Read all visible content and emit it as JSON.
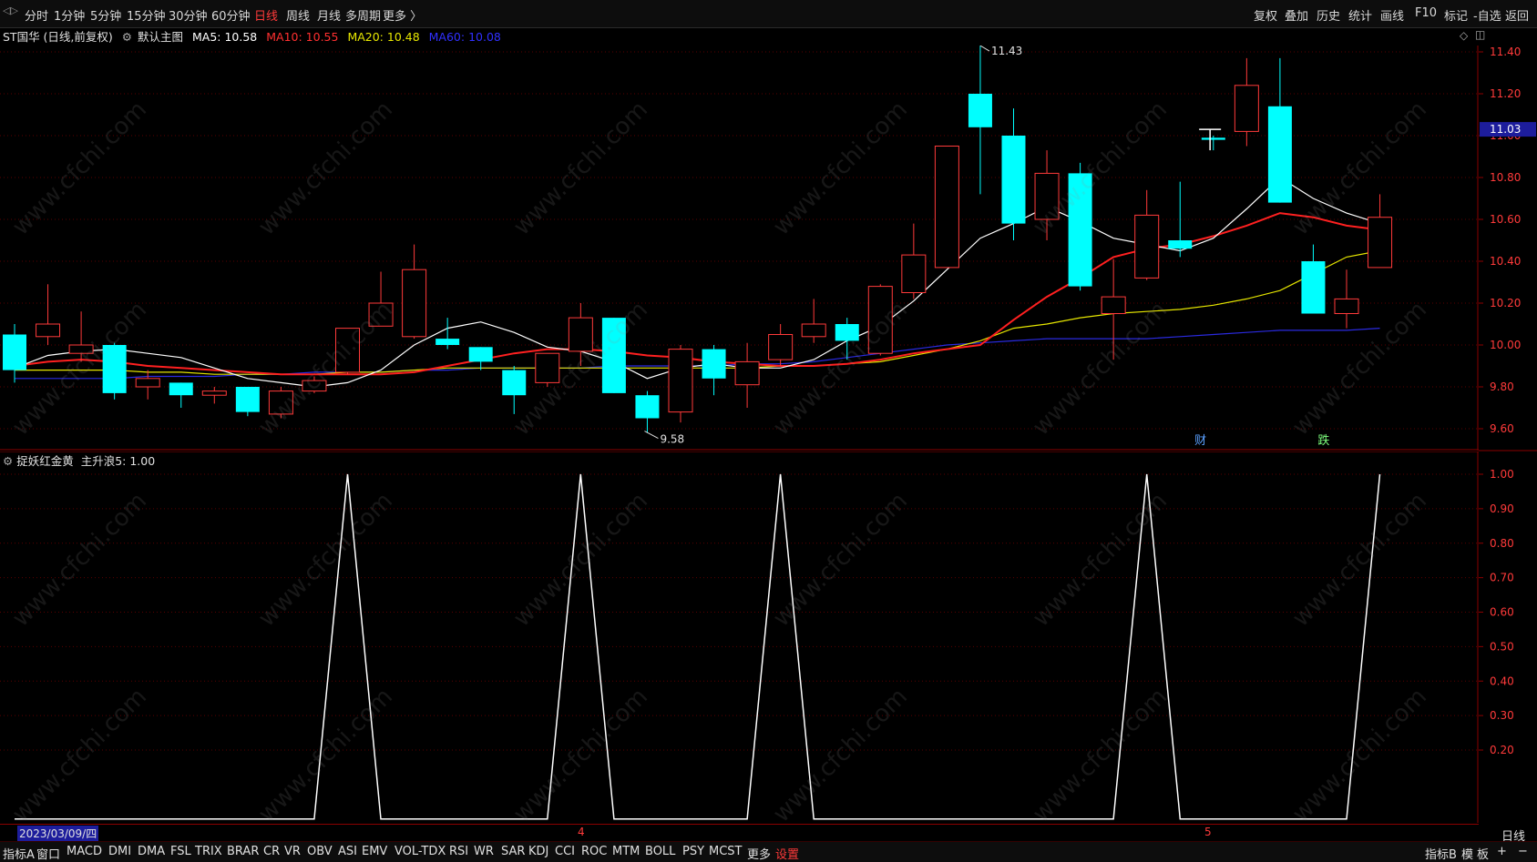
{
  "top_tabs": [
    "分时",
    "1分钟",
    "5分钟",
    "15分钟",
    "30分钟",
    "60分钟",
    "日线",
    "周线",
    "月线",
    "多周期",
    "更多 〉"
  ],
  "active_tab": "日线",
  "top_right": [
    "复权",
    "叠加",
    "历史",
    "统计",
    "画线",
    "F10",
    "标记",
    "-自选",
    "返回"
  ],
  "info": {
    "stock": "ST国华 (日线,前复权)",
    "template": "默认主图",
    "ma5": "MA5: 10.58",
    "ma10": "MA10: 10.55",
    "ma20": "MA20: 10.48",
    "ma60": "MA60: 10.08"
  },
  "colors": {
    "up": "#ff3a3a",
    "down": "#00ffff",
    "ma5": "#ffffff",
    "ma10": "#ff2020",
    "ma20": "#e6e600",
    "ma60": "#2a2ae0",
    "axis": "#8b0000",
    "grid": "#5a0000"
  },
  "main_axis": {
    "ticks": [
      "11.40",
      "11.20",
      "11.00",
      "10.80",
      "10.60",
      "10.40",
      "10.20",
      "10.00",
      "9.80",
      "9.60"
    ],
    "last_price": "11.03"
  },
  "annotations": {
    "high": "11.43",
    "low": "9.58",
    "tag1": "财",
    "tag2": "跌"
  },
  "sub": {
    "title": "捉妖红金黄",
    "line": "主升浪5: 1.00",
    "ticks": [
      "1.00",
      "0.90",
      "0.80",
      "0.70",
      "0.60",
      "0.50",
      "0.40",
      "0.30",
      "0.20"
    ]
  },
  "date_label": "2023/03/09/四",
  "month_marks": [
    "4",
    "5"
  ],
  "period_label": "日线",
  "bottom_tabs": [
    "指标A",
    "窗口",
    "MACD",
    "DMI",
    "DMA",
    "FSL",
    "TRIX",
    "BRAR",
    "CR",
    "VR",
    "OBV",
    "ASI",
    "EMV",
    "VOL-TDX",
    "RSI",
    "WR",
    "SAR",
    "KDJ",
    "CCI",
    "ROC",
    "MTM",
    "BOLL",
    "PSY",
    "MCST",
    "更多",
    "设置"
  ],
  "bottom_right": [
    "指标B",
    "模",
    "板",
    "+",
    "−"
  ],
  "watermark": "www.cfchi.com",
  "chart_data": {
    "type": "candlestick",
    "candles": [
      [
        10.05,
        9.88,
        10.1,
        9.82
      ],
      [
        10.04,
        10.1,
        10.29,
        10.0
      ],
      [
        9.96,
        10.0,
        10.16,
        9.92
      ],
      [
        10.0,
        9.77,
        10.01,
        9.74
      ],
      [
        9.8,
        9.84,
        9.88,
        9.74
      ],
      [
        9.82,
        9.76,
        9.82,
        9.7
      ],
      [
        9.76,
        9.78,
        9.8,
        9.72
      ],
      [
        9.8,
        9.68,
        9.8,
        9.66
      ],
      [
        9.67,
        9.78,
        9.8,
        9.65
      ],
      [
        9.78,
        9.83,
        9.85,
        9.77
      ],
      [
        9.87,
        10.08,
        10.08,
        9.86
      ],
      [
        10.09,
        10.2,
        10.35,
        10.09
      ],
      [
        10.04,
        10.36,
        10.48,
        10.03
      ],
      [
        10.03,
        10.0,
        10.13,
        9.98
      ],
      [
        9.99,
        9.92,
        9.99,
        9.88
      ],
      [
        9.88,
        9.76,
        9.9,
        9.67
      ],
      [
        9.82,
        9.96,
        9.96,
        9.8
      ],
      [
        9.97,
        10.13,
        10.2,
        9.9
      ],
      [
        10.13,
        9.77,
        10.13,
        9.77
      ],
      [
        9.76,
        9.65,
        9.78,
        9.58
      ],
      [
        9.68,
        9.98,
        10.0,
        9.63
      ],
      [
        9.98,
        9.84,
        10.0,
        9.76
      ],
      [
        9.81,
        9.92,
        10.01,
        9.7
      ],
      [
        9.93,
        10.05,
        10.1,
        9.9
      ],
      [
        10.04,
        10.1,
        10.22,
        10.01
      ],
      [
        10.1,
        10.02,
        10.13,
        9.93
      ],
      [
        9.96,
        10.28,
        10.29,
        9.95
      ],
      [
        10.25,
        10.43,
        10.58,
        10.22
      ],
      [
        10.37,
        10.95,
        10.95,
        10.37
      ],
      [
        11.2,
        11.04,
        11.43,
        10.72
      ],
      [
        11.0,
        10.58,
        11.13,
        10.5
      ],
      [
        10.6,
        10.82,
        10.93,
        10.5
      ],
      [
        10.82,
        10.28,
        10.87,
        10.26
      ],
      [
        10.15,
        10.23,
        10.41,
        9.93
      ],
      [
        10.32,
        10.62,
        10.74,
        10.31
      ],
      [
        10.5,
        10.46,
        10.78,
        10.42
      ],
      [
        10.99,
        10.98,
        11.0,
        10.93
      ],
      [
        11.02,
        11.24,
        11.37,
        10.95
      ],
      [
        11.14,
        10.68,
        11.37,
        10.68
      ],
      [
        10.4,
        10.15,
        10.48,
        10.15
      ],
      [
        10.15,
        10.22,
        10.36,
        10.08
      ],
      [
        10.37,
        10.61,
        10.72,
        10.37
      ]
    ],
    "ma5": [
      9.89,
      9.95,
      9.97,
      9.98,
      9.96,
      9.94,
      9.89,
      9.84,
      9.82,
      9.8,
      9.82,
      9.88,
      10.0,
      10.08,
      10.11,
      10.06,
      9.99,
      9.97,
      9.92,
      9.84,
      9.89,
      9.91,
      9.89,
      9.89,
      9.93,
      10.02,
      10.09,
      10.21,
      10.36,
      10.51,
      10.58,
      10.66,
      10.59,
      10.51,
      10.48,
      10.45,
      10.51,
      10.65,
      10.8,
      10.7,
      10.63,
      10.58
    ],
    "ma10": [
      9.9,
      9.92,
      9.93,
      9.92,
      9.9,
      9.89,
      9.88,
      9.87,
      9.86,
      9.86,
      9.86,
      9.86,
      9.87,
      9.9,
      9.93,
      9.96,
      9.98,
      9.98,
      9.97,
      9.95,
      9.94,
      9.92,
      9.91,
      9.9,
      9.9,
      9.91,
      9.93,
      9.96,
      9.98,
      10.0,
      10.12,
      10.23,
      10.32,
      10.42,
      10.46,
      10.48,
      10.52,
      10.57,
      10.63,
      10.61,
      10.57,
      10.55
    ],
    "ma20": [
      9.88,
      9.88,
      9.88,
      9.88,
      9.87,
      9.87,
      9.86,
      9.86,
      9.86,
      9.86,
      9.87,
      9.87,
      9.88,
      9.89,
      9.89,
      9.89,
      9.89,
      9.89,
      9.89,
      9.89,
      9.89,
      9.89,
      9.89,
      9.9,
      9.9,
      9.91,
      9.92,
      9.95,
      9.98,
      10.02,
      10.08,
      10.1,
      10.13,
      10.15,
      10.16,
      10.17,
      10.19,
      10.22,
      10.26,
      10.34,
      10.42,
      10.45,
      10.48
    ],
    "ma60": [
      9.84,
      9.84,
      9.84,
      9.84,
      9.85,
      9.85,
      9.85,
      9.86,
      9.86,
      9.87,
      9.87,
      9.87,
      9.88,
      9.88,
      9.89,
      9.89,
      9.89,
      9.89,
      9.9,
      9.9,
      9.9,
      9.9,
      9.91,
      9.91,
      9.92,
      9.94,
      9.96,
      9.98,
      10.0,
      10.01,
      10.02,
      10.03,
      10.03,
      10.03,
      10.03,
      10.04,
      10.05,
      10.06,
      10.07,
      10.07,
      10.07,
      10.08
    ],
    "indicator": [
      0,
      0,
      0,
      0,
      0,
      0,
      0,
      0,
      0,
      0,
      1,
      0,
      0,
      0,
      0,
      0,
      0,
      1,
      0,
      0,
      0,
      0,
      0,
      1,
      0,
      0,
      0,
      0,
      0,
      0,
      0,
      0,
      0,
      0,
      1,
      0,
      0,
      0,
      0,
      0,
      0,
      1
    ],
    "ylim": [
      9.52,
      11.5
    ],
    "sub_ylim": [
      0,
      1.06
    ]
  }
}
